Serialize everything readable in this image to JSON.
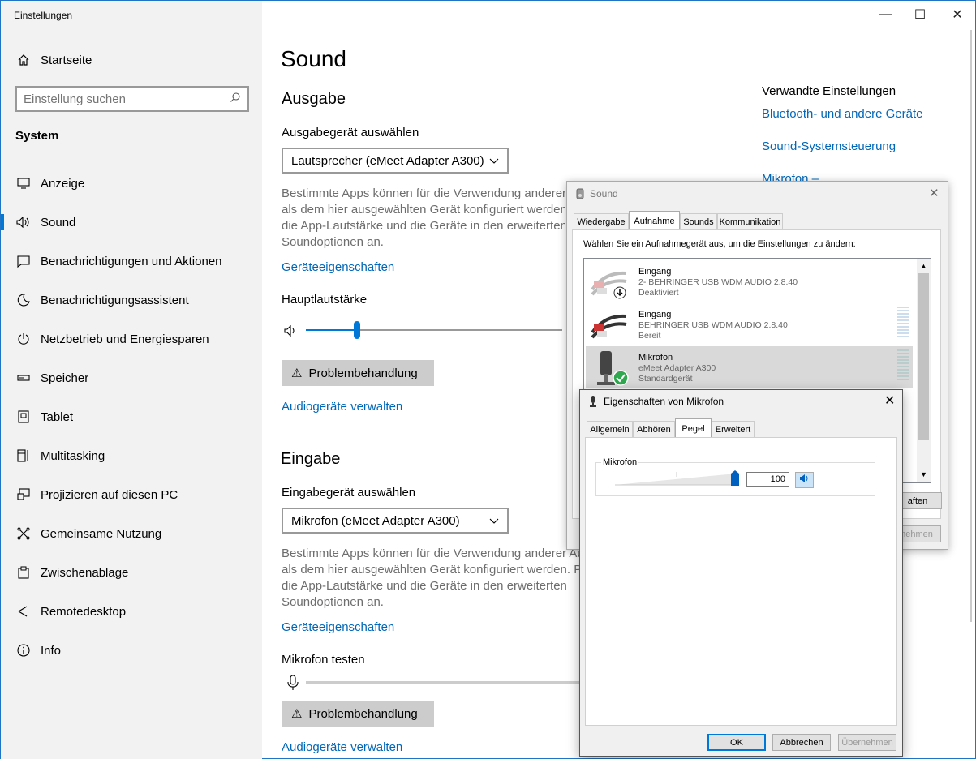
{
  "window": {
    "title": "Einstellungen",
    "minimize": "—",
    "maximize": "☐",
    "close": "✕"
  },
  "sidebar": {
    "home": "Startseite",
    "search_placeholder": "Einstellung suchen",
    "section": "System",
    "items": [
      {
        "label": "Anzeige",
        "icon": "monitor-icon"
      },
      {
        "label": "Sound",
        "icon": "speaker-icon"
      },
      {
        "label": "Benachrichtigungen und Aktionen",
        "icon": "notification-icon"
      },
      {
        "label": "Benachrichtigungsassistent",
        "icon": "moon-icon"
      },
      {
        "label": "Netzbetrieb und Energiesparen",
        "icon": "power-icon"
      },
      {
        "label": "Speicher",
        "icon": "storage-icon"
      },
      {
        "label": "Tablet",
        "icon": "tablet-icon"
      },
      {
        "label": "Multitasking",
        "icon": "multitasking-icon"
      },
      {
        "label": "Projizieren auf diesen PC",
        "icon": "project-icon"
      },
      {
        "label": "Gemeinsame Nutzung",
        "icon": "share-icon"
      },
      {
        "label": "Zwischenablage",
        "icon": "clipboard-icon"
      },
      {
        "label": "Remotedesktop",
        "icon": "remote-icon"
      },
      {
        "label": "Info",
        "icon": "info-icon"
      }
    ]
  },
  "main": {
    "title": "Sound",
    "output": {
      "heading": "Ausgabe",
      "device_label": "Ausgabegerät auswählen",
      "device_value": "Lautsprecher (eMeet Adapter A300)",
      "info": "Bestimmte Apps können für die Verwendung anderer",
      "info2": "als dem hier ausgewählten Gerät konfiguriert werden",
      "info3": "die App-Lautstärke und die Geräte in den erweiterten",
      "info4": "Soundoptionen an.",
      "properties_link": "Geräteeigenschaften",
      "volume_label": "Hauptlautstärke",
      "volume": 0.2,
      "troubleshoot": "Problembehandlung",
      "manage_link": "Audiogeräte verwalten"
    },
    "input": {
      "heading": "Eingabe",
      "device_label": "Eingabegerät auswählen",
      "device_value": "Mikrofon (eMeet Adapter A300)",
      "info": "Bestimmte Apps können für die Verwendung anderer",
      "info_cut": "Au",
      "info2": "als dem hier ausgewählten Gerät konfiguriert werden. Pa",
      "info3": "die App-Lautstärke und die Geräte in den erweiterten",
      "info4": "Soundoptionen an.",
      "properties_link": "Geräteeigenschaften",
      "test_label": "Mikrofon testen",
      "troubleshoot": "Problembehandlung",
      "manage_link": "Audiogeräte verwalten"
    }
  },
  "related": {
    "heading": "Verwandte Einstellungen",
    "links": [
      "Bluetooth- und andere Geräte",
      "Sound-Systemsteuerung",
      "Mikrofon –"
    ]
  },
  "sound_dialog": {
    "title": "Sound",
    "tabs": [
      "Wiedergabe",
      "Aufnahme",
      "Sounds",
      "Kommunikation"
    ],
    "active_tab": "Aufnahme",
    "instruction": "Wählen Sie ein Aufnahmegerät aus, um die Einstellungen zu ändern:",
    "devices": [
      {
        "name": "Eingang",
        "desc": "2- BEHRINGER USB WDM AUDIO 2.8.40",
        "status": "Deaktiviert"
      },
      {
        "name": "Eingang",
        "desc": "BEHRINGER USB WDM AUDIO 2.8.40",
        "status": "Bereit"
      },
      {
        "name": "Mikrofon",
        "desc": "eMeet Adapter A300",
        "status": "Standardgerät"
      }
    ],
    "properties_btn_partial": "aften",
    "apply_partial": "nehmen"
  },
  "props_dialog": {
    "title": "Eigenschaften von Mikrofon",
    "tabs": [
      "Allgemein",
      "Abhören",
      "Pegel",
      "Erweitert"
    ],
    "active_tab": "Pegel",
    "group_label": "Mikrofon",
    "level_value": "100",
    "ok": "OK",
    "cancel": "Abbrechen",
    "apply": "Übernehmen"
  }
}
